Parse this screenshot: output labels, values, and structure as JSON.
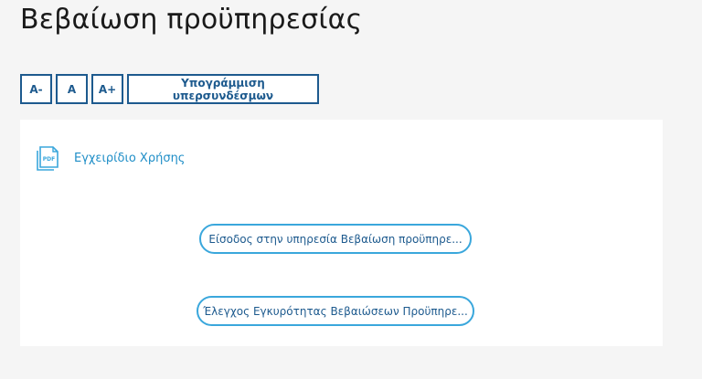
{
  "page": {
    "title": "Βεβαίωση προϋπηρεσίας"
  },
  "toolbar": {
    "font_decrease_label": "A-",
    "font_normal_label": "A",
    "font_increase_label": "A+",
    "underline_links_label": "Υπογράμμιση υπερσυνδέσμων"
  },
  "content": {
    "manual": {
      "label": "Εγχειρίδιο Χρήσης",
      "icon": "pdf-icon",
      "icon_text": "PDF"
    },
    "buttons": [
      {
        "label": "Είσοδος στην υπηρεσία Βεβαίωση προϋπηρε..."
      },
      {
        "label": "Έλεγχος Εγκυρότητας Βεβαιώσεων Προϋπηρε..."
      }
    ]
  },
  "colors": {
    "background": "#f5f5f5",
    "toolbar_border": "#1d5a8e",
    "link": "#1f8ec7",
    "pill_border": "#3aa7dc"
  }
}
